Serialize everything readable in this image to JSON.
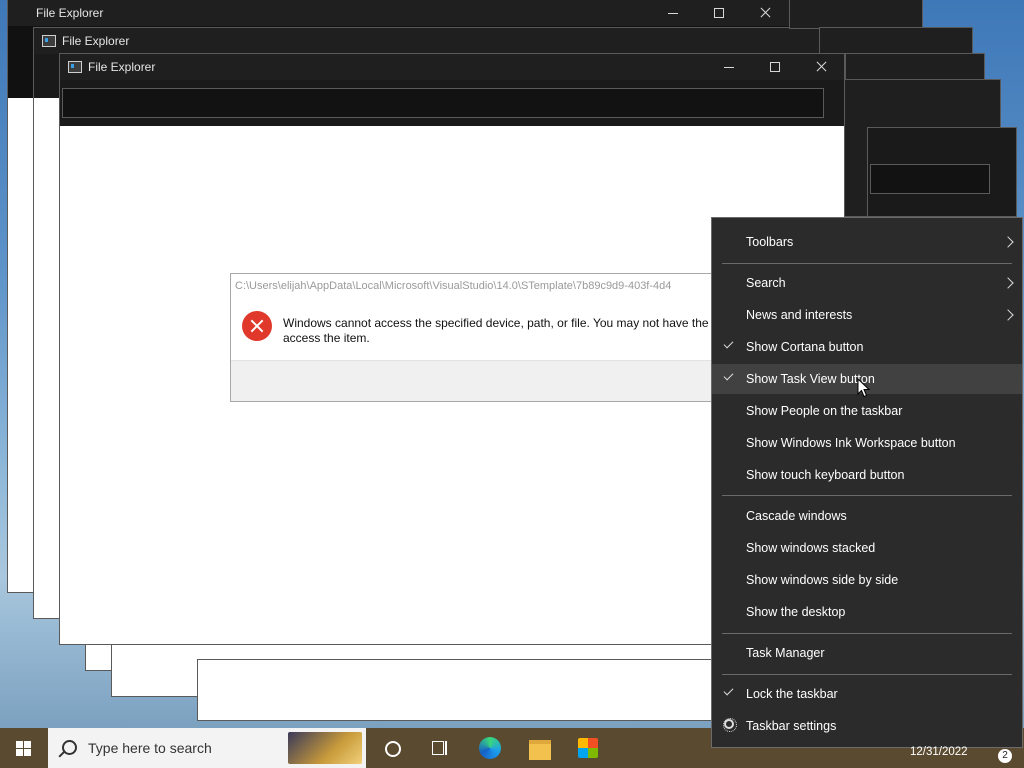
{
  "windows": [
    {
      "title": "File Explorer"
    },
    {
      "title": "File Explorer"
    },
    {
      "title": "File Explorer"
    }
  ],
  "error_dialog": {
    "path": "C:\\Users\\elijah\\AppData\\Local\\Microsoft\\VisualStudio\\14.0\\STemplate\\7b89c9d9-403f-4d4",
    "message": "Windows cannot access the specified device, path, or file. You may not have the a permissions to access the item."
  },
  "context_menu": {
    "items": [
      {
        "label": "Toolbars",
        "checked": false,
        "submenu": true
      },
      {
        "label": "Search",
        "checked": false,
        "submenu": true
      },
      {
        "label": "News and interests",
        "checked": false,
        "submenu": true
      },
      {
        "label": "Show Cortana button",
        "checked": true,
        "submenu": false
      },
      {
        "label": "Show Task View button",
        "checked": true,
        "submenu": false,
        "hovered": true
      },
      {
        "label": "Show People on the taskbar",
        "checked": false,
        "submenu": false
      },
      {
        "label": "Show Windows Ink Workspace button",
        "checked": false,
        "submenu": false
      },
      {
        "label": "Show touch keyboard button",
        "checked": false,
        "submenu": false
      },
      {
        "label": "Cascade windows",
        "checked": false,
        "submenu": false
      },
      {
        "label": "Show windows stacked",
        "checked": false,
        "submenu": false
      },
      {
        "label": "Show windows side by side",
        "checked": false,
        "submenu": false
      },
      {
        "label": "Show the desktop",
        "checked": false,
        "submenu": false
      },
      {
        "label": "Task Manager",
        "checked": false,
        "submenu": false
      },
      {
        "label": "Lock the taskbar",
        "checked": true,
        "submenu": false
      },
      {
        "label": "Taskbar settings",
        "checked": false,
        "submenu": false,
        "icon": "gear-icon"
      }
    ]
  },
  "taskbar": {
    "search_placeholder": "Type here to search",
    "date": "12/31/2022",
    "notification_count": "2",
    "icons": [
      "windows-start-icon",
      "search-icon",
      "cortana-icon",
      "task-view-icon",
      "edge-icon",
      "file-explorer-icon",
      "store-icon"
    ]
  },
  "colors": {
    "menu_bg": "#2b2b2b",
    "taskbar_bg": "#5a4a2f",
    "error_red": "#e0392b",
    "titlebar_bg": "#1f1f1f"
  }
}
